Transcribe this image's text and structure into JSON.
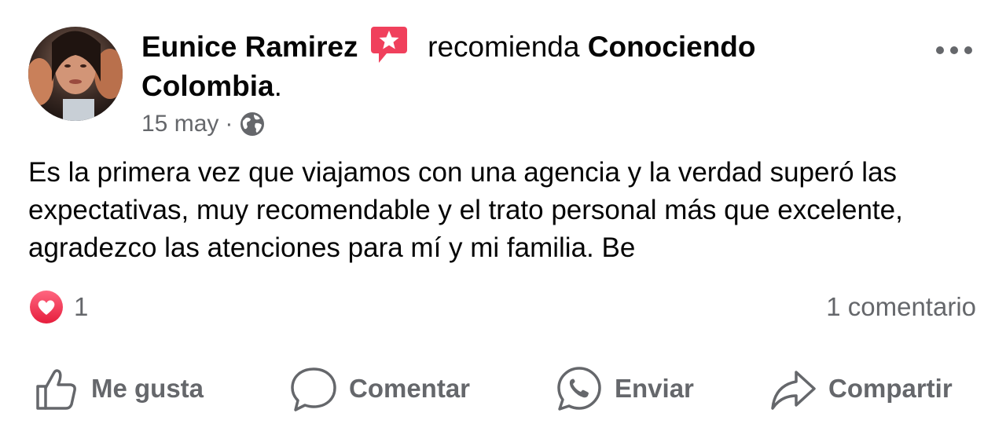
{
  "post": {
    "author_name": "Eunice Ramirez",
    "action_text": "recomienda",
    "page_name_part1": "Conociendo",
    "page_name_part2": "Colombia",
    "page_name_suffix": ".",
    "date": "15 may",
    "separator": "·",
    "privacy_icon": "globe-icon",
    "recommend_icon": "recommendation-star-icon",
    "more_icon": "more-options-icon",
    "body": "Es la primera vez que viajamos con una agencia y la verdad superó las expectativas, muy recomendable y el trato personal más que excelente, agradezco las atenciones para mí y mi familia. Be"
  },
  "reactions": {
    "icon": "heart-reaction-icon",
    "count": "1",
    "comments": "1 comentario"
  },
  "actions": [
    {
      "label": "Me gusta",
      "icon": "thumbs-up-icon"
    },
    {
      "label": "Comentar",
      "icon": "comment-bubble-icon"
    },
    {
      "label": "Enviar",
      "icon": "whatsapp-icon"
    },
    {
      "label": "Compartir",
      "icon": "share-arrow-icon"
    }
  ],
  "colors": {
    "text_primary": "#050505",
    "text_secondary": "#65676b",
    "recommend_red": "#f0405c",
    "heart_red": "#f33e58"
  }
}
